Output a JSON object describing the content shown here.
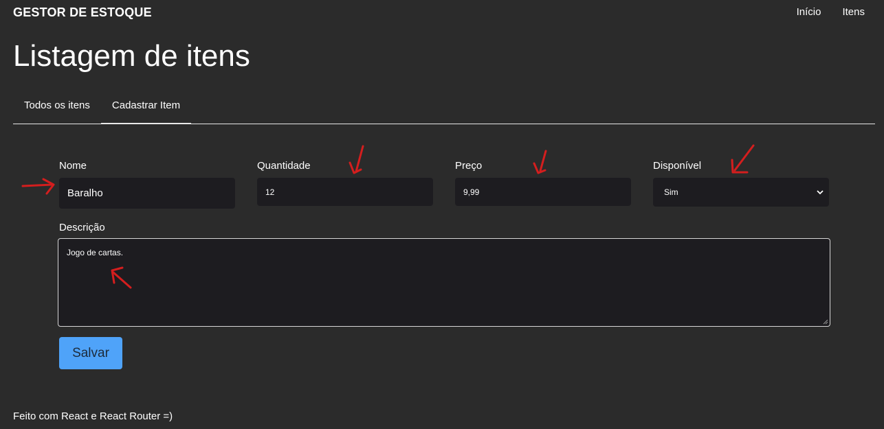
{
  "header": {
    "brand": "GESTOR DE ESTOQUE",
    "nav": [
      "Início",
      "Itens"
    ]
  },
  "main": {
    "title": "Listagem de itens",
    "tabs": [
      {
        "label": "Todos os itens",
        "active": false
      },
      {
        "label": "Cadastrar Item",
        "active": true
      }
    ]
  },
  "form": {
    "nome": {
      "label": "Nome",
      "value": "Baralho"
    },
    "quantidade": {
      "label": "Quantidade",
      "value": "12"
    },
    "preco": {
      "label": "Preço",
      "value": "9,99"
    },
    "disponivel": {
      "label": "Disponível",
      "value": "Sim"
    },
    "descricao": {
      "label": "Descrição",
      "value": "Jogo de cartas."
    },
    "save_label": "Salvar"
  },
  "footer": {
    "text": "Feito com React e React Router =)"
  },
  "colors": {
    "background": "#2b2b2b",
    "input_bg": "#1d1c20",
    "primary_button": "#4fa3f9",
    "annotation": "#d41e1e"
  },
  "icons": {
    "select_arrow": "chevron-down-icon",
    "annotations": "red-hand-drawn-arrow"
  }
}
